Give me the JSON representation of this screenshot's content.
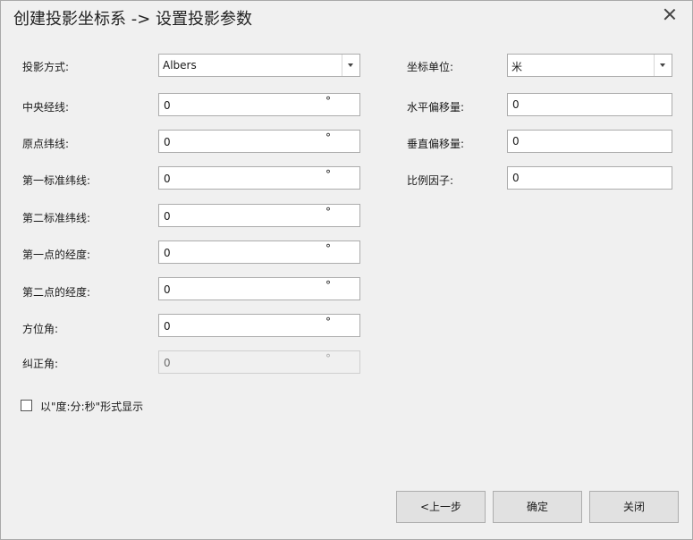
{
  "dialog": {
    "title": "创建投影坐标系 -> 设置投影参数"
  },
  "left": {
    "projection_label": "投影方式:",
    "projection_value": "Albers",
    "fields": [
      {
        "label": "中央经线:",
        "value": "0",
        "unit": "°"
      },
      {
        "label": "原点纬线:",
        "value": "0",
        "unit": "°"
      },
      {
        "label": "第一标准纬线:",
        "value": "0",
        "unit": "°"
      },
      {
        "label": "第二标准纬线:",
        "value": "0",
        "unit": "°"
      },
      {
        "label": "第一点的经度:",
        "value": "0",
        "unit": "°"
      },
      {
        "label": "第二点的经度:",
        "value": "0",
        "unit": "°"
      },
      {
        "label": "方位角:",
        "value": "0",
        "unit": "°"
      },
      {
        "label": "纠正角:",
        "value": "0",
        "unit": "°"
      }
    ]
  },
  "right": {
    "unit_label": "坐标单位:",
    "unit_value": "米",
    "fields": [
      {
        "label": "水平偏移量:",
        "value": "0"
      },
      {
        "label": "垂直偏移量:",
        "value": "0"
      },
      {
        "label": "比例因子:",
        "value": "0"
      }
    ]
  },
  "options": {
    "dms_label": "以\"度:分:秒\"形式显示"
  },
  "buttons": {
    "prev": "<上一步",
    "ok": "确定",
    "close": "关闭"
  }
}
